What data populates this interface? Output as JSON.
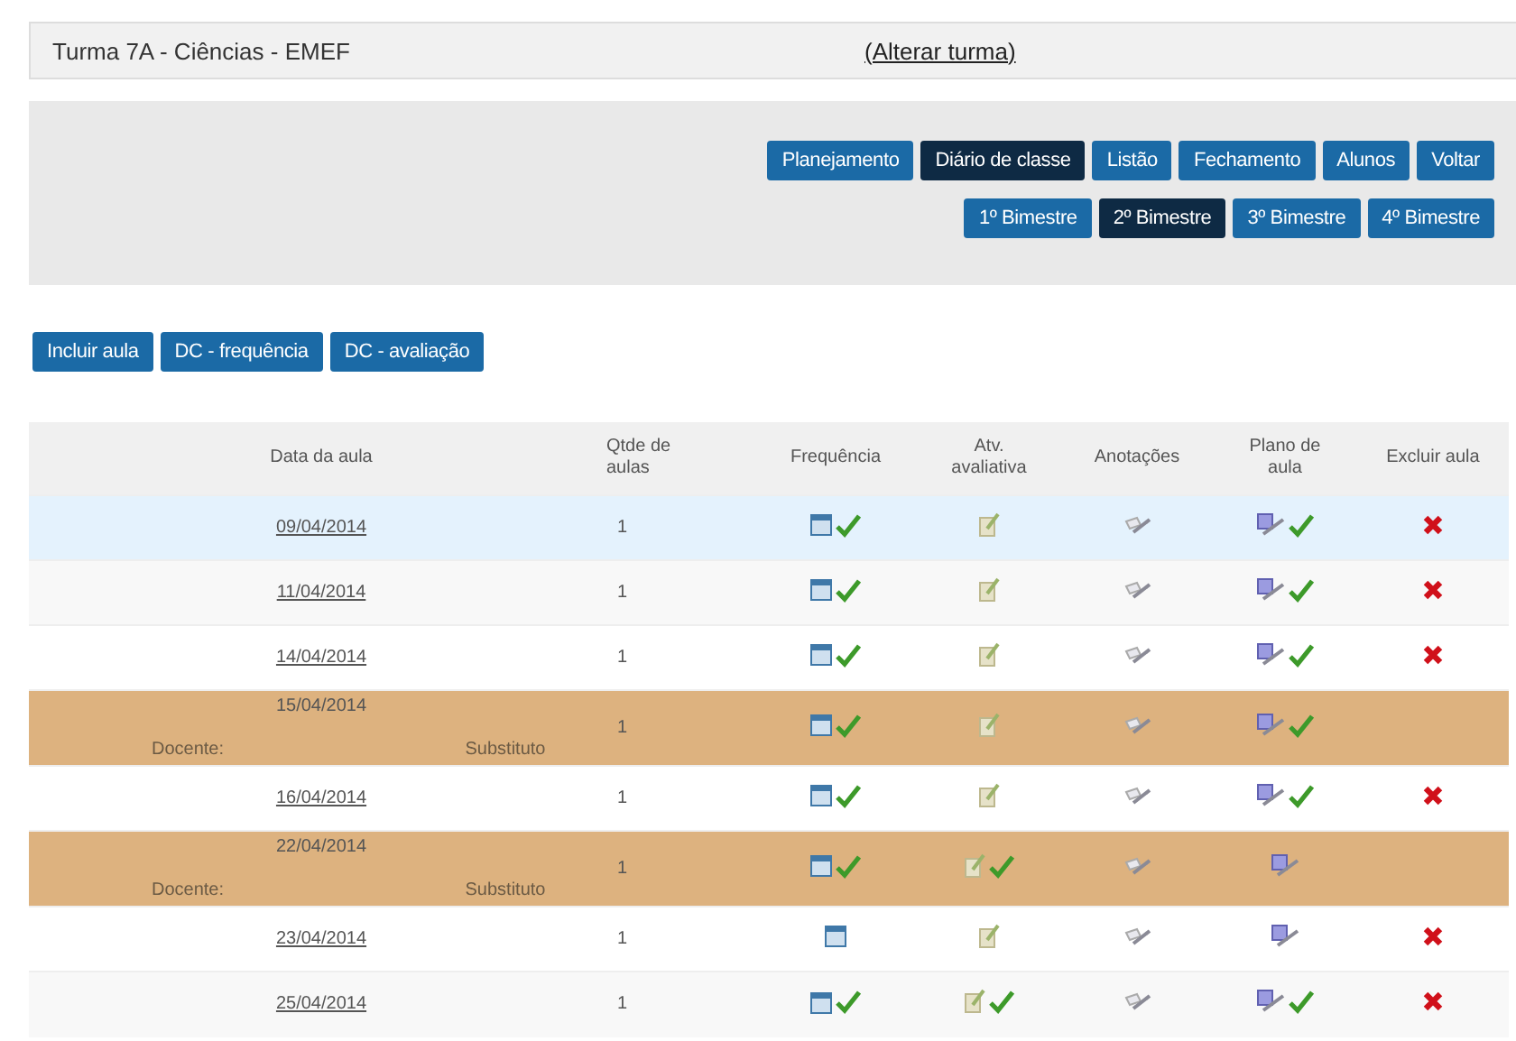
{
  "header": {
    "title": "Turma 7A - Ciências - EMEF",
    "change_link": "(Alterar turma)"
  },
  "nav_buttons": [
    {
      "label": "Planejamento",
      "selected": false
    },
    {
      "label": "Diário de classe",
      "selected": true
    },
    {
      "label": "Listão",
      "selected": false
    },
    {
      "label": "Fechamento",
      "selected": false
    },
    {
      "label": "Alunos",
      "selected": false
    },
    {
      "label": "Voltar",
      "selected": false
    }
  ],
  "term_tabs": [
    {
      "label": "1º Bimestre",
      "selected": false
    },
    {
      "label": "2º Bimestre",
      "selected": true
    },
    {
      "label": "3º Bimestre",
      "selected": false
    },
    {
      "label": "4º Bimestre",
      "selected": false
    }
  ],
  "actions": [
    "Incluir aula",
    "DC - frequência",
    "DC - avaliação"
  ],
  "table": {
    "columns": [
      "Data da aula",
      "Qtde de aulas",
      "Frequência",
      "Atv. avaliativa",
      "Anotações",
      "Plano de aula",
      "Excluir aula"
    ],
    "rows": [
      {
        "kind": "regular",
        "selected": true,
        "date": "09/04/2014",
        "quantity": "1",
        "attendance_done": true,
        "assessment_done": false,
        "plan_done": true,
        "deletable": true
      },
      {
        "kind": "regular",
        "selected": false,
        "date": "11/04/2014",
        "quantity": "1",
        "attendance_done": true,
        "assessment_done": false,
        "plan_done": true,
        "deletable": true
      },
      {
        "kind": "regular",
        "selected": false,
        "date": "14/04/2014",
        "quantity": "1",
        "attendance_done": true,
        "assessment_done": false,
        "plan_done": true,
        "deletable": true
      },
      {
        "kind": "substitute",
        "selected": false,
        "teacher_label": "Docente:",
        "date": "15/04/2014",
        "substitute_label": "Substituto",
        "quantity": "1",
        "attendance_done": true,
        "assessment_done": false,
        "plan_done": true,
        "deletable": false
      },
      {
        "kind": "regular",
        "selected": false,
        "date": "16/04/2014",
        "quantity": "1",
        "attendance_done": true,
        "assessment_done": false,
        "plan_done": true,
        "deletable": true
      },
      {
        "kind": "substitute",
        "selected": false,
        "teacher_label": "Docente:",
        "date": "22/04/2014",
        "substitute_label": "Substituto",
        "quantity": "1",
        "attendance_done": true,
        "assessment_done": true,
        "plan_done": false,
        "deletable": false
      },
      {
        "kind": "regular",
        "selected": false,
        "date": "23/04/2014",
        "quantity": "1",
        "attendance_done": false,
        "assessment_done": false,
        "plan_done": false,
        "deletable": true
      },
      {
        "kind": "regular",
        "selected": false,
        "date": "25/04/2014",
        "quantity": "1",
        "attendance_done": true,
        "assessment_done": true,
        "plan_done": true,
        "deletable": true
      }
    ]
  }
}
